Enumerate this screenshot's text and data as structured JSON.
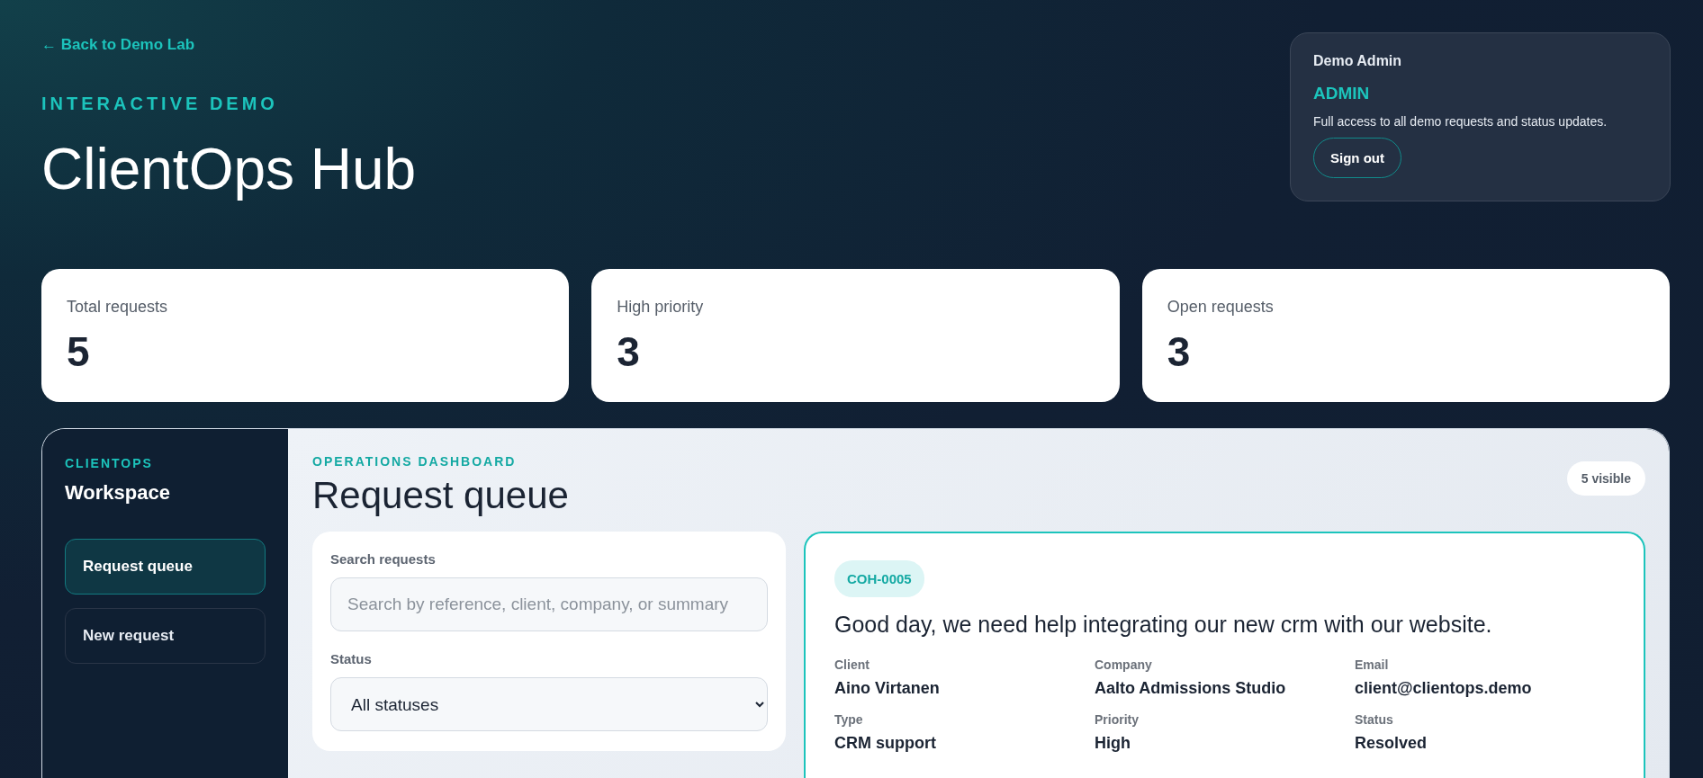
{
  "back_link": {
    "arrow": "←",
    "label": "Back to Demo Lab"
  },
  "eyebrow": "INTERACTIVE DEMO",
  "title": "ClientOps Hub",
  "user_card": {
    "name": "Demo Admin",
    "role": "ADMIN",
    "description": "Full access to all demo requests and status updates.",
    "button": "Sign out"
  },
  "stats": [
    {
      "label": "Total requests",
      "value": "5"
    },
    {
      "label": "High priority",
      "value": "3"
    },
    {
      "label": "Open requests",
      "value": "3"
    }
  ],
  "sidebar": {
    "eyebrow": "CLIENTOPS",
    "title": "Workspace",
    "items": [
      {
        "label": "Request queue",
        "selected": true
      },
      {
        "label": "New request",
        "selected": false
      }
    ]
  },
  "dashboard": {
    "eyebrow": "OPERATIONS DASHBOARD",
    "title": "Request queue",
    "visible_badge": "5 visible"
  },
  "filters": {
    "search_label": "Search requests",
    "search_placeholder": "Search by reference, client, company, or summary",
    "status_label": "Status",
    "status_value": "All statuses"
  },
  "request": {
    "reference": "COH-0005",
    "summary": "Good day, we need help integrating our new crm with our website.",
    "fields": [
      {
        "label": "Client",
        "value": "Aino Virtanen"
      },
      {
        "label": "Company",
        "value": "Aalto Admissions Studio"
      },
      {
        "label": "Email",
        "value": "client@clientops.demo"
      },
      {
        "label": "Type",
        "value": "CRM support"
      },
      {
        "label": "Priority",
        "value": "High"
      },
      {
        "label": "Status",
        "value": "Resolved"
      }
    ]
  }
}
